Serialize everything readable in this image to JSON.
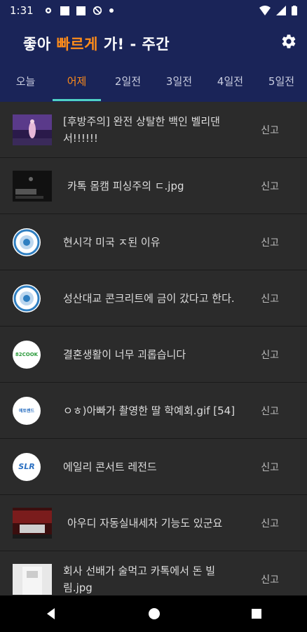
{
  "status": {
    "time": "1:31"
  },
  "header": {
    "title_pre": "좋아 ",
    "title_accent": "빠르게",
    "title_post": " 가! - 주간"
  },
  "tabs": [
    {
      "label": "오늘"
    },
    {
      "label": "어제"
    },
    {
      "label": "2일전"
    },
    {
      "label": "3일전"
    },
    {
      "label": "4일전"
    },
    {
      "label": "5일전"
    }
  ],
  "active_tab": "어제",
  "report_label": "신고",
  "posts": [
    {
      "title": "[후방주의] 완전 상탈한 백인 벨리댄서!!!!!!",
      "thumb": "photo"
    },
    {
      "title": "카톡 몸캠 피싱주의 ㄷ.jpg",
      "thumb": "photo"
    },
    {
      "title": "현시각 미국 ㅈ된 이유",
      "thumb": "logo"
    },
    {
      "title": "성산대교 콘크리트에 금이 갔다고 한다.",
      "thumb": "logo"
    },
    {
      "title": "결혼생활이 너무 괴롭습니다",
      "thumb": "logo"
    },
    {
      "title": "ㅇㅎ)아빠가 촬영한 딸 학예회.gif [54]",
      "thumb": "logo"
    },
    {
      "title": "에일리 콘서트 레전드",
      "thumb": "logo"
    },
    {
      "title": "아우디 자동실내세차 기능도 있군요",
      "thumb": "photo"
    },
    {
      "title": "회사 선배가 술먹고 카톡에서 돈 빌림.jpg",
      "thumb": "photo"
    }
  ],
  "logo_text": {
    "eighty": "82COOK",
    "etoland": "에토랜드",
    "slr": "SLR"
  },
  "colors": {
    "header_bg": "#1a2458",
    "accent": "#ff8c1a",
    "indicator": "#4fd1c5",
    "list_bg": "#2b2b2b"
  }
}
